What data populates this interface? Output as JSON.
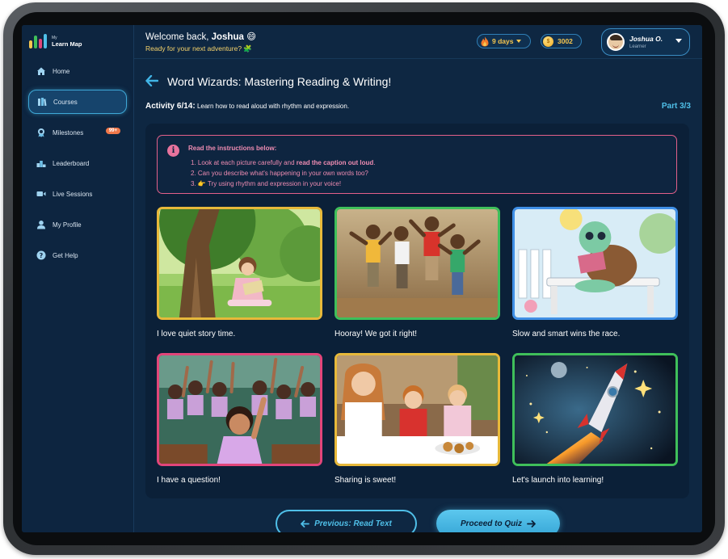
{
  "logo": {
    "small": "My",
    "name": "Learn Map"
  },
  "sidebar": {
    "items": [
      {
        "label": "Home",
        "icon": "home-icon"
      },
      {
        "label": "Courses",
        "icon": "books-icon",
        "active": true
      },
      {
        "label": "Milestones",
        "icon": "medal-icon",
        "badge": "99+"
      },
      {
        "label": "Leaderboard",
        "icon": "podium-icon"
      },
      {
        "label": "Live Sessions",
        "icon": "video-icon"
      },
      {
        "label": "My Profile",
        "icon": "user-icon"
      },
      {
        "label": "Get Help",
        "icon": "help-icon"
      }
    ]
  },
  "header": {
    "welcome_prefix": "Welcome back, ",
    "user_first": "Joshua",
    "welcome_emoji": "😄",
    "subtitle": "Ready for your next adventure? 🧩",
    "streak": "9 days",
    "coins": "3002",
    "profile_name": "Joshua O.",
    "profile_role": "Learner"
  },
  "course": {
    "title": "Word Wizards: Mastering Reading & Writing!",
    "activity_label": "Activity 6/14:",
    "activity_desc": "Learn how to read aloud with rhythm and expression.",
    "part": "Part 3/3"
  },
  "instructions": {
    "heading": "Read the instructions below:",
    "line1_prefix": "1. Look at each picture carefully and ",
    "line1_bold": "read the caption out loud",
    "line1_suffix": ".",
    "line2": "2. Can you describe what's happening in your own words too?",
    "line3": "3. 👉 Try using rhythm and expression in your voice!"
  },
  "cards": [
    {
      "caption": "I love quiet story time.",
      "border": "#e7b93a"
    },
    {
      "caption": "Hooray! We got it right!",
      "border": "#3fbf5a"
    },
    {
      "caption": "Slow and smart wins the race.",
      "border": "#3f8fe6"
    },
    {
      "caption": "I have a question!",
      "border": "#e2457a"
    },
    {
      "caption": "Sharing is sweet!",
      "border": "#e7b93a"
    },
    {
      "caption": "Let's launch into learning!",
      "border": "#3fbf5a"
    }
  ],
  "buttons": {
    "previous": "Previous: Read Text",
    "next": "Proceed to Quiz"
  },
  "colors": {
    "accent": "#4fbfe8",
    "background": "#0e2742",
    "instruction_pink": "#ee8cb2",
    "gold": "#f5c64f"
  }
}
